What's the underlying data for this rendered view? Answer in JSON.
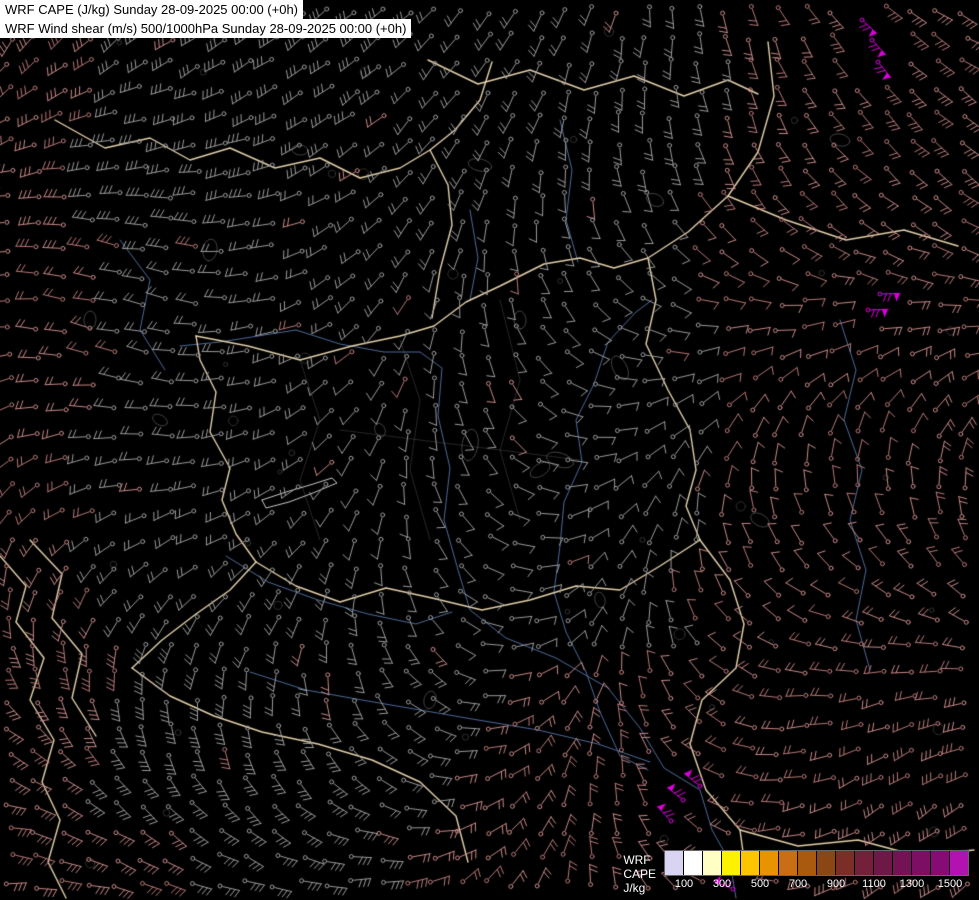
{
  "header": {
    "title_line1": "WRF CAPE (J/kg) Sunday 28-09-2025 00:00 (+0h)",
    "title_line2": "WRF Wind shear (m/s) 500/1000hPa Sunday 28-09-2025 00:00 (+0h)"
  },
  "legend": {
    "model_label": "WRF",
    "variable_label": "CAPE",
    "units_label": "J/kg",
    "tick_labels": [
      "100",
      "300",
      "500",
      "700",
      "900",
      "1100",
      "1300",
      "1500"
    ],
    "swatch_colors": [
      "#d8d4f2",
      "#ffffff",
      "#ffffc4",
      "#fff200",
      "#fdc500",
      "#e89400",
      "#c86e14",
      "#aa5a0f",
      "#8a4613",
      "#7c2d25",
      "#74203a",
      "#6e1847",
      "#731254",
      "#7c0e63",
      "#860b74",
      "#b312b3"
    ]
  },
  "map": {
    "background_color": "#000000",
    "barb_color_low_shear": "#9c9c9c",
    "barb_color_mid_shear": "#c98989",
    "barb_color_mid_shear_dark": "#b87878",
    "barb_color_high_shear": "#dd00dd",
    "country_border_color": "#f0dcb4",
    "river_color": "#5577aa",
    "contour_color": "#808080",
    "lake_color": "#dddddd"
  }
}
